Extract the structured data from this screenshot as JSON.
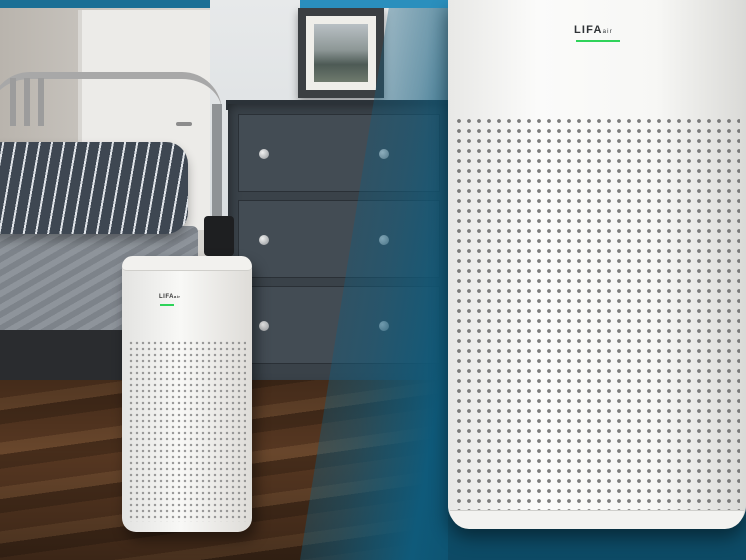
{
  "image": {
    "scene": "bedroom",
    "subject": "air-purifier"
  },
  "small_purifier": {
    "logo_text": "LIFA",
    "logo_suffix": "air",
    "indicator_color": "#2fd35a"
  },
  "big_purifier": {
    "logo_text": "LIFA",
    "logo_suffix": "air",
    "indicator_color": "#2fd35a"
  },
  "colors": {
    "accent_teal": "#0f5a7a",
    "top_bar": "#1b6f95"
  }
}
